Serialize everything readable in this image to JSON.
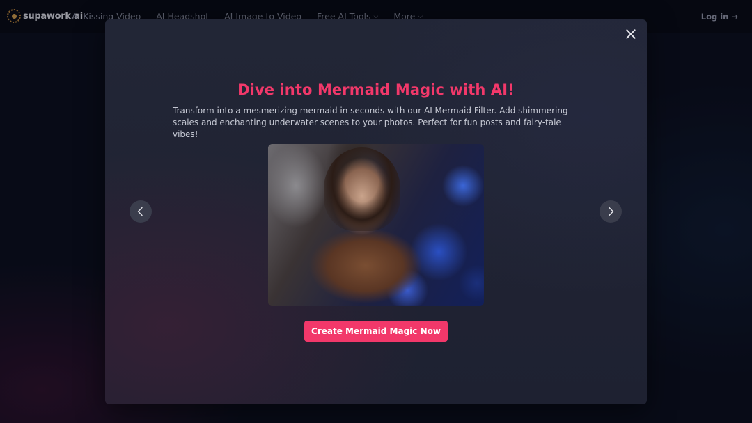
{
  "nav": {
    "logo_text": "supawork.ai",
    "items": [
      {
        "label": "AI Kissing Video",
        "has_dropdown": false
      },
      {
        "label": "AI Headshot",
        "has_dropdown": false
      },
      {
        "label": "AI Image to Video",
        "has_dropdown": false
      },
      {
        "label": "Free AI Tools",
        "has_dropdown": true
      },
      {
        "label": "More",
        "has_dropdown": true
      }
    ],
    "login_label": "Log in →"
  },
  "modal": {
    "title": "Dive into Mermaid Magic with AI!",
    "description": "Transform into a mesmerizing mermaid in seconds with our AI Mermaid Filter. Add shimmering scales and enchanting underwater scenes to your photos. Perfect for fun posts and fairy-tale vibes!",
    "cta_label": "Create Mermaid Magic Now",
    "close_icon": "close-icon",
    "prev_icon": "chevron-left-icon",
    "next_icon": "chevron-right-icon"
  },
  "colors": {
    "accent": "#f2386a",
    "modal_bg": "#222636",
    "page_bg": "#0a0d1b"
  }
}
